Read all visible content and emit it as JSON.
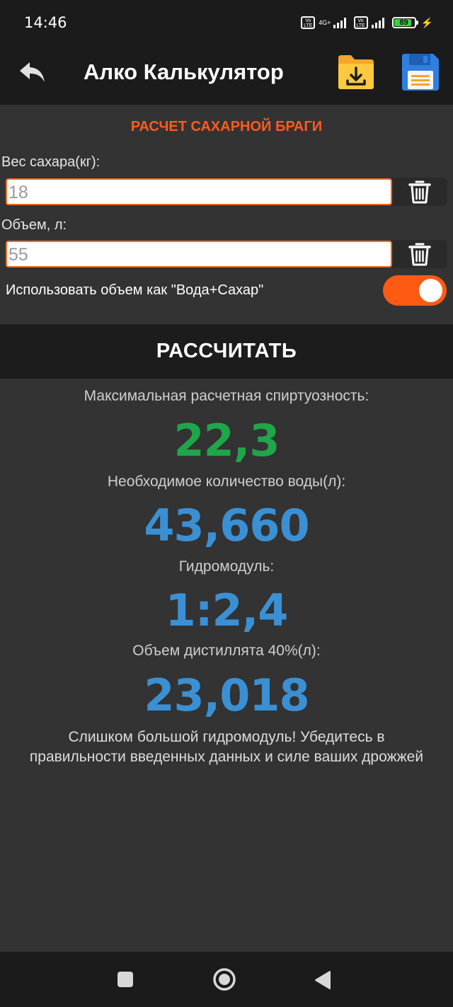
{
  "status_bar": {
    "time": "14:46",
    "volte1": "Vo LTE",
    "network": "4G+",
    "volte2": "Vo LTE",
    "battery": "89",
    "battery_level": 0.89,
    "icons": [
      "volte-icon",
      "signal-icon",
      "volte-icon",
      "signal-icon",
      "battery-icon",
      "charging-icon"
    ]
  },
  "app_bar": {
    "title": "Алко Калькулятор",
    "icons": [
      "back-arrow-icon",
      "folder-download-icon",
      "floppy-save-icon"
    ]
  },
  "form": {
    "section_title": "РАСЧЕТ САХАРНОЙ БРАГИ",
    "sugar_label": "Вес сахара(кг):",
    "sugar_value": "18",
    "volume_label": "Объем, л:",
    "volume_value": "55",
    "toggle_label": "Использовать объем как \"Вода+Сахар\"",
    "toggle_on": true
  },
  "calculate_label": "РАССЧИТАТЬ",
  "results": {
    "max_abv_label": "Максимальная расчетная спиртуозность:",
    "max_abv_value": "22,3",
    "water_label": "Необходимое количество воды(л):",
    "water_value": "43,660",
    "hydromodule_label": "Гидромодуль:",
    "hydromodule_value": "1:2,4",
    "distillate_label": "Объем дистиллята 40%(л):",
    "distillate_value": "23,018",
    "warning_line1": "Слишком большой гидромодуль! Убедитесь в",
    "warning_line2": "правильности введенных данных и силе ваших дрожжей"
  },
  "colors": {
    "accent": "#ff5a1f",
    "green_value": "#1fa64a",
    "blue_value": "#3b90d4",
    "background": "#333333",
    "bar": "#1b1b1b"
  },
  "nav_bar": {
    "icons": [
      "recents-square-icon",
      "home-circle-icon",
      "back-triangle-icon"
    ]
  }
}
